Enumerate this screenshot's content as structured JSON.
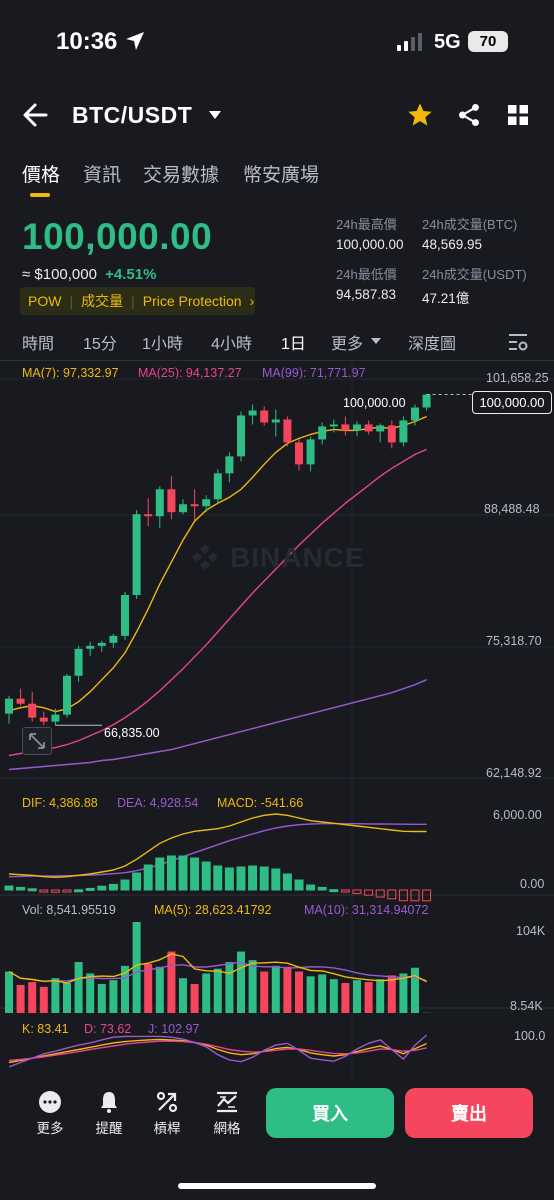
{
  "status": {
    "time": "10:36",
    "network": "5G",
    "battery": "70"
  },
  "header": {
    "pair": "BTC/USDT"
  },
  "tabs": [
    {
      "label": "價格"
    },
    {
      "label": "資訊"
    },
    {
      "label": "交易數據"
    },
    {
      "label": "幣安廣場"
    }
  ],
  "price": {
    "last": "100,000.00",
    "fiat": "≈ $100,000",
    "change": "+4.51%"
  },
  "badge": {
    "tag1": "POW",
    "tag2": "成交量",
    "tag3": "Price Protection",
    "arrow": "›"
  },
  "stats": {
    "high_label": "24h最高價",
    "high": "100,000.00",
    "vol_btc_label": "24h成交量(BTC)",
    "vol_btc": "48,569.95",
    "low_label": "24h最低價",
    "low": "94,587.83",
    "vol_usdt_label": "24h成交量(USDT)",
    "vol_usdt": "47.21億"
  },
  "intervals": {
    "time": "時間",
    "m15": "15分",
    "h1": "1小時",
    "h4": "4小時",
    "d1": "1日",
    "more": "更多",
    "depth": "深度圖"
  },
  "ma": {
    "ma7": "MA(7): 97,332.97",
    "ma25": "MA(25): 94,137.27",
    "ma99": "MA(99): 71,771.97"
  },
  "price_axis": [
    "101,658.25",
    "88,488.48",
    "75,318.70",
    "62,148.92"
  ],
  "price_tag": "100,000.00",
  "high_marker": "100,000.00",
  "low_marker": "66,835.00",
  "watermark": "BINANCE",
  "macd": {
    "dif": "DIF: 4,386.88",
    "dea": "DEA: 4,928.54",
    "macd": "MACD: -541.66",
    "axis_top": "6,000.00",
    "axis_bottom": "0.00"
  },
  "vol": {
    "vol": "Vol: 8,541.95519",
    "ma5": "MA(5): 28,623.41792",
    "ma10": "MA(10): 31,314.94072",
    "axis_top": "104K",
    "axis_bottom": "8.54K"
  },
  "kdj": {
    "k": "K: 83.41",
    "d": "D: 73.62",
    "j": "J: 102.97",
    "axis_top": "100.0"
  },
  "bottom": {
    "more": "更多",
    "alert": "提醒",
    "leverage": "槓桿",
    "grid": "網格",
    "buy": "買入",
    "sell": "賣出"
  },
  "colors": {
    "up": "#2ebd85",
    "down": "#f6465d",
    "accent": "#f0b90b",
    "ma7": "#f0b90b",
    "ma25": "#e84393",
    "ma99": "#9b59d0"
  },
  "chart_data": {
    "type": "candlestick",
    "symbol": "BTC/USDT",
    "interval": "1日",
    "ylim": [
      62148.92,
      101658.25
    ],
    "candles": [
      {
        "o": 68000,
        "h": 69800,
        "l": 67000,
        "c": 69500
      },
      {
        "o": 69500,
        "h": 70500,
        "l": 68800,
        "c": 69000
      },
      {
        "o": 69000,
        "h": 70200,
        "l": 67200,
        "c": 67600
      },
      {
        "o": 67600,
        "h": 68200,
        "l": 66835,
        "c": 67200
      },
      {
        "o": 67200,
        "h": 68500,
        "l": 66835,
        "c": 67900
      },
      {
        "o": 67900,
        "h": 72000,
        "l": 67600,
        "c": 71800
      },
      {
        "o": 71800,
        "h": 74800,
        "l": 71200,
        "c": 74500
      },
      {
        "o": 74500,
        "h": 75200,
        "l": 73800,
        "c": 74800
      },
      {
        "o": 74800,
        "h": 75300,
        "l": 74200,
        "c": 75100
      },
      {
        "o": 75100,
        "h": 76000,
        "l": 74600,
        "c": 75800
      },
      {
        "o": 75800,
        "h": 80200,
        "l": 75400,
        "c": 79900
      },
      {
        "o": 79900,
        "h": 88400,
        "l": 79500,
        "c": 88000
      },
      {
        "o": 88000,
        "h": 89600,
        "l": 86800,
        "c": 87800
      },
      {
        "o": 87800,
        "h": 90800,
        "l": 86600,
        "c": 90500
      },
      {
        "o": 90500,
        "h": 91800,
        "l": 87500,
        "c": 88200
      },
      {
        "o": 88200,
        "h": 89500,
        "l": 88000,
        "c": 89000
      },
      {
        "o": 89000,
        "h": 90500,
        "l": 87400,
        "c": 88800
      },
      {
        "o": 88800,
        "h": 89900,
        "l": 88200,
        "c": 89500
      },
      {
        "o": 89500,
        "h": 92500,
        "l": 89000,
        "c": 92100
      },
      {
        "o": 92100,
        "h": 94200,
        "l": 91200,
        "c": 93800
      },
      {
        "o": 93800,
        "h": 98300,
        "l": 93300,
        "c": 97900
      },
      {
        "o": 97900,
        "h": 99000,
        "l": 97000,
        "c": 98400
      },
      {
        "o": 98400,
        "h": 98800,
        "l": 96900,
        "c": 97200
      },
      {
        "o": 97200,
        "h": 98500,
        "l": 95800,
        "c": 97500
      },
      {
        "o": 97500,
        "h": 97800,
        "l": 94800,
        "c": 95200
      },
      {
        "o": 95200,
        "h": 95500,
        "l": 92400,
        "c": 93000
      },
      {
        "o": 93000,
        "h": 95800,
        "l": 92300,
        "c": 95500
      },
      {
        "o": 95500,
        "h": 97200,
        "l": 95000,
        "c": 96800
      },
      {
        "o": 96800,
        "h": 97500,
        "l": 96200,
        "c": 97000
      },
      {
        "o": 97000,
        "h": 97800,
        "l": 95900,
        "c": 96400
      },
      {
        "o": 96400,
        "h": 97300,
        "l": 95800,
        "c": 97000
      },
      {
        "o": 97000,
        "h": 97400,
        "l": 96000,
        "c": 96300
      },
      {
        "o": 96300,
        "h": 97100,
        "l": 95200,
        "c": 96900
      },
      {
        "o": 96900,
        "h": 97400,
        "l": 94600,
        "c": 95200
      },
      {
        "o": 95200,
        "h": 97800,
        "l": 94800,
        "c": 97400
      },
      {
        "o": 97400,
        "h": 99000,
        "l": 96900,
        "c": 98700
      },
      {
        "o": 98700,
        "h": 100000,
        "l": 98400,
        "c": 100000
      }
    ],
    "ma7": [
      68300,
      68600,
      68800,
      68600,
      68200,
      68500,
      69200,
      70200,
      71400,
      72600,
      74100,
      76200,
      78500,
      81000,
      83200,
      85400,
      87300,
      88400,
      89100,
      89700,
      90500,
      91700,
      93000,
      94200,
      95100,
      95600,
      96000,
      96300,
      96500,
      96400,
      96400,
      96600,
      96700,
      96600,
      96900,
      97300,
      97800
    ],
    "ma25": [
      63800,
      64000,
      64200,
      64400,
      64600,
      64900,
      65300,
      65800,
      66300,
      66900,
      67600,
      68400,
      69300,
      70300,
      71400,
      72500,
      73700,
      74900,
      76200,
      77500,
      78800,
      80100,
      81300,
      82500,
      83700,
      84900,
      86000,
      87100,
      88100,
      89100,
      90000,
      90900,
      91800,
      92600,
      93300,
      94000,
      94500
    ],
    "ma99": [
      62400,
      62500,
      62600,
      62700,
      62800,
      62900,
      63000,
      63100,
      63300,
      63400,
      63600,
      63800,
      64000,
      64200,
      64400,
      64700,
      65000,
      65300,
      65600,
      65900,
      66200,
      66500,
      66800,
      67100,
      67400,
      67700,
      68000,
      68300,
      68600,
      68900,
      69200,
      69500,
      69800,
      70100,
      70500,
      70900,
      71400
    ],
    "macd": {
      "dif": [
        1200,
        1150,
        1100,
        1000,
        950,
        1000,
        1100,
        1200,
        1350,
        1500,
        1800,
        2300,
        2900,
        3500,
        3900,
        4200,
        4400,
        4500,
        4600,
        4800,
        5100,
        5400,
        5600,
        5700,
        5600,
        5400,
        5200,
        5100,
        5000,
        4900,
        4800,
        4700,
        4600,
        4500,
        4400,
        4390,
        4386.88
      ],
      "dea": [
        1000,
        1020,
        1040,
        1050,
        1060,
        1070,
        1090,
        1120,
        1160,
        1220,
        1300,
        1450,
        1650,
        1900,
        2200,
        2500,
        2800,
        3100,
        3400,
        3700,
        3950,
        4200,
        4450,
        4650,
        4800,
        4900,
        4950,
        4970,
        4980,
        4975,
        4970,
        4960,
        4950,
        4940,
        4935,
        4930,
        4928.54
      ],
      "axis": [
        0,
        6000
      ]
    },
    "volume": {
      "values": [
        52000,
        38000,
        41000,
        36000,
        45000,
        40000,
        62000,
        50000,
        39000,
        43000,
        58000,
        104000,
        60000,
        57000,
        73000,
        45000,
        39000,
        50000,
        55000,
        62000,
        73000,
        64000,
        52000,
        58000,
        57000,
        52000,
        47000,
        49000,
        44000,
        40000,
        43000,
        41000,
        44000,
        48000,
        50000,
        56000,
        8541.96
      ],
      "up": [
        true,
        false,
        false,
        false,
        true,
        true,
        true,
        true,
        true,
        true,
        true,
        true,
        false,
        true,
        false,
        true,
        false,
        true,
        true,
        true,
        true,
        true,
        false,
        true,
        false,
        false,
        true,
        true,
        true,
        false,
        true,
        false,
        true,
        false,
        true,
        true,
        true
      ],
      "axis": [
        8540,
        104000
      ]
    },
    "kdj": {
      "k": 83.41,
      "d": 73.62,
      "j": 102.97
    }
  }
}
